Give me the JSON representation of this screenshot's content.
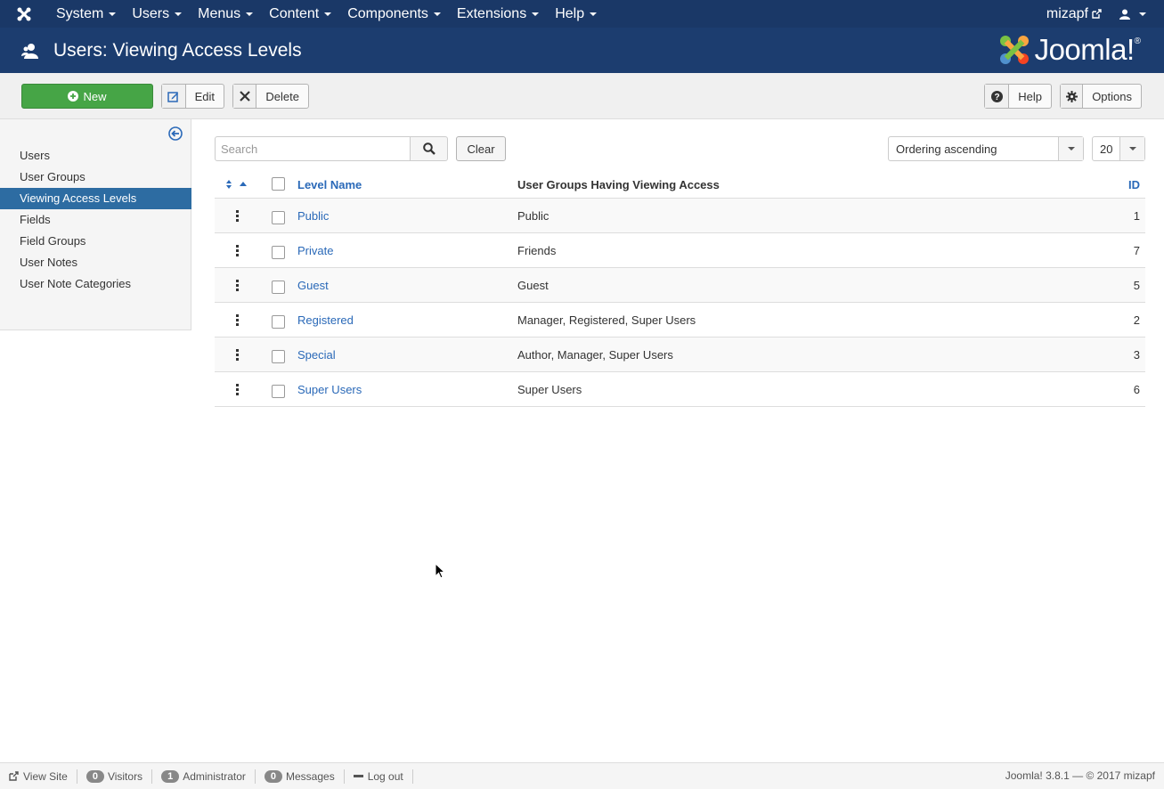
{
  "navbar": {
    "menu": [
      {
        "label": "System"
      },
      {
        "label": "Users"
      },
      {
        "label": "Menus"
      },
      {
        "label": "Content"
      },
      {
        "label": "Components"
      },
      {
        "label": "Extensions"
      },
      {
        "label": "Help"
      }
    ],
    "username": "mizapf"
  },
  "header": {
    "title": "Users: Viewing Access Levels",
    "logo_text": "Joomla!",
    "logo_reg": "®"
  },
  "toolbar": {
    "new_label": "New",
    "edit_label": "Edit",
    "delete_label": "Delete",
    "help_label": "Help",
    "options_label": "Options"
  },
  "sidebar": {
    "items": [
      {
        "label": "Users"
      },
      {
        "label": "User Groups"
      },
      {
        "label": "Viewing Access Levels",
        "active": true
      },
      {
        "label": "Fields"
      },
      {
        "label": "Field Groups"
      },
      {
        "label": "User Notes"
      },
      {
        "label": "User Note Categories"
      }
    ]
  },
  "filters": {
    "search_placeholder": "Search",
    "search_value": "",
    "clear_label": "Clear",
    "ordering": "Ordering ascending",
    "limit": "20"
  },
  "table": {
    "headers": {
      "level_name": "Level Name",
      "groups": "User Groups Having Viewing Access",
      "id": "ID"
    },
    "rows": [
      {
        "name": "Public",
        "groups": "Public",
        "id": "1"
      },
      {
        "name": "Private",
        "groups": "Friends",
        "id": "7"
      },
      {
        "name": "Guest",
        "groups": "Guest",
        "id": "5"
      },
      {
        "name": "Registered",
        "groups": "Manager, Registered, Super Users",
        "id": "2"
      },
      {
        "name": "Special",
        "groups": "Author, Manager, Super Users",
        "id": "3"
      },
      {
        "name": "Super Users",
        "groups": "Super Users",
        "id": "6"
      }
    ]
  },
  "status": {
    "view_site": "View Site",
    "visitors_count": "0",
    "visitors_label": "Visitors",
    "admin_count": "1",
    "admin_label": "Administrator",
    "messages_count": "0",
    "messages_label": "Messages",
    "logout_label": "Log out",
    "copyright": "Joomla! 3.8.1 — © 2017 mizapf"
  },
  "colors": {
    "navbar": "#1a3867",
    "header": "#1c3d6f",
    "new_button": "#46a546",
    "active_sidebar": "#2d6ca2",
    "link": "#2a69b8"
  }
}
